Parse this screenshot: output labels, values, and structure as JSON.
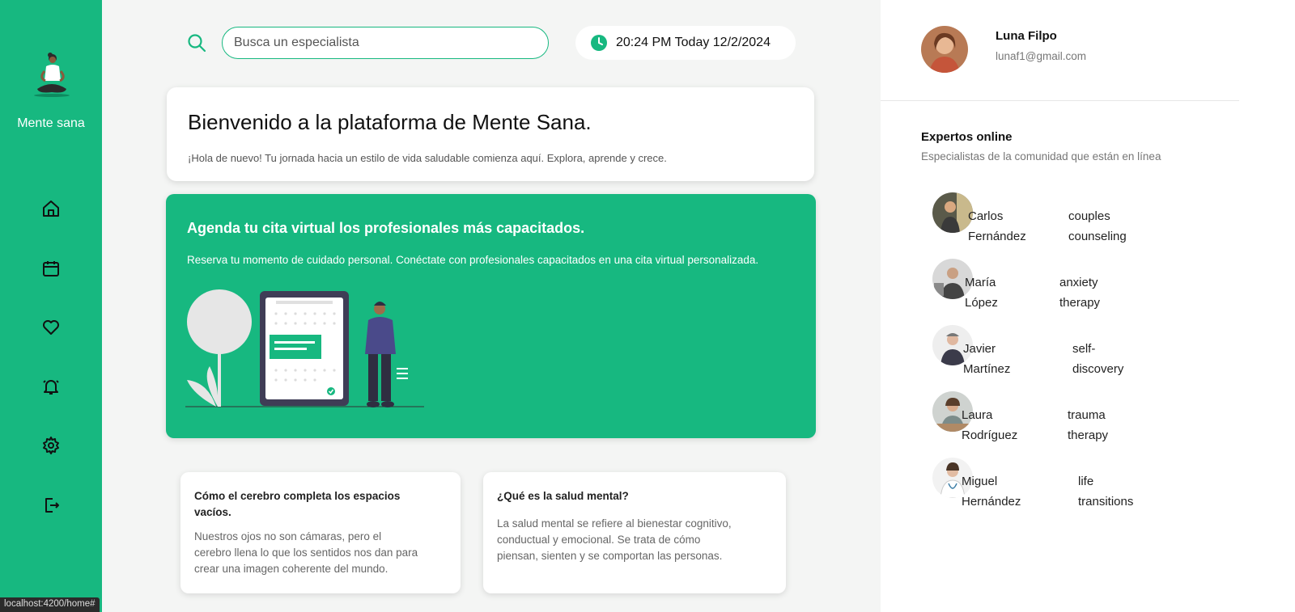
{
  "app": {
    "brand": "Mente sana"
  },
  "sidebar": {
    "items": [
      {
        "icon": "home-icon"
      },
      {
        "icon": "calendar-icon"
      },
      {
        "icon": "heart-icon"
      },
      {
        "icon": "bell-icon"
      },
      {
        "icon": "gear-icon"
      },
      {
        "icon": "logout-icon"
      }
    ]
  },
  "header": {
    "search_placeholder": "Busca un especialista",
    "datetime": "20:24 PM Today 12/2/2024"
  },
  "welcome": {
    "title": "Bienvenido a la plataforma de Mente Sana.",
    "subtitle": "¡Hola de nuevo! Tu jornada hacia un estilo de vida saludable comienza aquí. Explora, aprende y crece."
  },
  "promo": {
    "title": "Agenda tu cita virtual los profesionales más capacitados.",
    "text": "Reserva tu momento de cuidado personal. Conéctate con profesionales capacitados en una cita virtual personalizada."
  },
  "articles": [
    {
      "title_lines": [
        "Cómo el cerebro completa los espacios",
        "vacíos."
      ],
      "body_lines": [
        "Nuestros ojos no son cámaras, pero el",
        "cerebro llena lo que los sentidos nos dan para",
        "crear una imagen coherente del mundo."
      ]
    },
    {
      "title_lines": [
        "¿Qué es la salud mental?"
      ],
      "body_lines": [
        "La salud mental se refiere al bienestar cognitivo,",
        "conductual y emocional. Se trata de cómo",
        "piensan, sienten y se comportan las personas."
      ]
    }
  ],
  "profile": {
    "name": "Luna Filpo",
    "email": "lunaf1@gmail.com"
  },
  "experts": {
    "title": "Expertos online",
    "subtitle": "Especialistas de la comunidad que están en línea",
    "list": [
      {
        "first": "Carlos",
        "last": "Fernández",
        "spec1": "couples",
        "spec2": "counseling"
      },
      {
        "first": "María",
        "last": "López",
        "spec1": "anxiety",
        "spec2": "therapy"
      },
      {
        "first": "Javier",
        "last": "Martínez",
        "spec1": "self-",
        "spec2": "discovery"
      },
      {
        "first": "Laura",
        "last": "Rodríguez",
        "spec1": "trauma",
        "spec2": "therapy"
      },
      {
        "first": "Miguel",
        "last": "Hernández",
        "spec1": "life",
        "spec2": "transitions"
      }
    ]
  },
  "status_bar": {
    "url": "localhost:4200/home#"
  },
  "colors": {
    "accent": "#17b880",
    "background": "#f4f5f4"
  }
}
